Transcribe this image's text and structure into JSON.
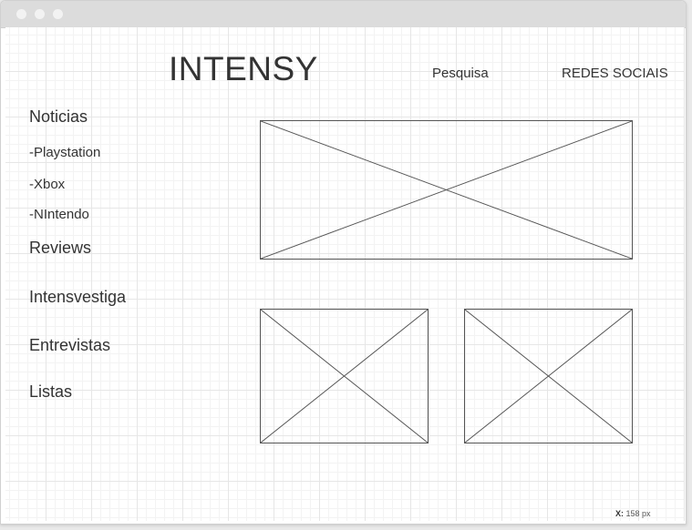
{
  "header": {
    "logo": "INTENSY",
    "search_label": "Pesquisa",
    "social_label": "REDES SOCIAIS"
  },
  "sidebar": {
    "items": [
      {
        "label": "Noticias"
      },
      {
        "label": "-Playstation"
      },
      {
        "label": "-Xbox"
      },
      {
        "label": "-NIntendo"
      },
      {
        "label": "Reviews"
      },
      {
        "label": "Intensvestiga"
      },
      {
        "label": "Entrevistas"
      },
      {
        "label": "Listas"
      }
    ]
  },
  "status": {
    "x_label": "X:",
    "x_value": "158 px"
  },
  "colors": {
    "titlebar": "#dcdcdc",
    "grid_major": "#e6e6e6",
    "grid_minor": "#f3f3f3",
    "text": "#333333",
    "stroke": "#555555"
  },
  "icons": {
    "window_controls": "window-dot-icon",
    "image_placeholder": "image-placeholder-icon"
  }
}
